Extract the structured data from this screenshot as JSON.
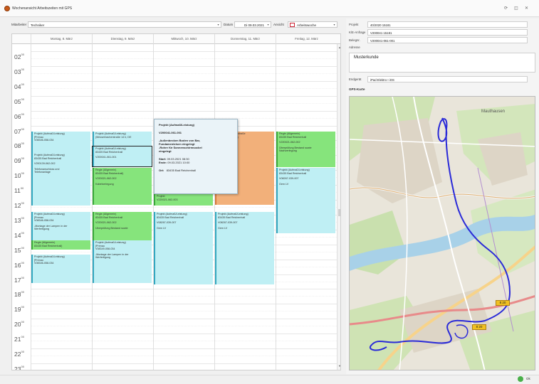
{
  "window": {
    "title": "Wochenansicht Arbeitszeiten mit GPS",
    "controls": [
      "⟳",
      "◫",
      "✕"
    ]
  },
  "toolbar": {
    "mitarbeiter_label": "Mitarbeiter",
    "mitarbeiter_value": "Techniker",
    "datum_label": "Datum",
    "datum_value": "Di 09.03.2021",
    "ansicht_label": "Ansicht",
    "ansicht_value": "Arbeitswoche"
  },
  "calendar": {
    "days": [
      "Montag, 8. März",
      "Dienstag, 9. März",
      "Mittwoch, 10. März",
      "Donnerstag, 11. März",
      "Freitag, 12. März"
    ],
    "hours": [
      "02",
      "03",
      "04",
      "05",
      "06",
      "07",
      "08",
      "09",
      "10",
      "11",
      "12",
      "13",
      "14",
      "15",
      "16",
      "17",
      "18",
      "19",
      "20",
      "21",
      "22",
      "23"
    ],
    "hour_suffix": "00",
    "events": [
      {
        "id": "mo1",
        "lines": [
          "Projekt (Aufmaß/Leistung)",
          "[Prenau",
          "V08346-058-034"
        ]
      },
      {
        "id": "mo2",
        "lines": [
          "Projekt (Aufmaß/Leistung)",
          "83435 Bad Reichenhall",
          "",
          "V200139-062-002",
          "",
          "Telefonanschluss und",
          "Telefonanlage"
        ]
      },
      {
        "id": "mo3",
        "lines": [
          "Projekt (Aufmaß/Leistung)",
          "[Prenau",
          "V08346-058-034",
          "",
          "-Montage der Lampen in der",
          "Werfertigung"
        ]
      },
      {
        "id": "mo4",
        "lines": [
          "Regie (Allgemein)",
          "83435 Bad Reichenhall)"
        ]
      },
      {
        "id": "mo5",
        "lines": [
          "Projekt (Aufmaß/Leistung)",
          "[Prenau",
          "V08346-058-034"
        ]
      },
      {
        "id": "di1",
        "lines": [
          "Projekt (Aufmaß/Leistung)",
          "(Messerbacherstraße 14 b, DE"
        ]
      },
      {
        "id": "di2",
        "lines": [
          "Projekt (Aufmaß/Leistung)",
          "83435 Bad Reichenhall",
          "",
          "V200041-061-001"
        ]
      },
      {
        "id": "di3",
        "lines": [
          "Regie (Allgemein)",
          "83435 Bad Reichenhall)",
          "",
          "V220021-062-002",
          "",
          "Kabelverlegung"
        ]
      },
      {
        "id": "di4",
        "lines": [
          "Regie (Allgemein)",
          "83435 Bad Reichenhall",
          "",
          "V220021-062-002",
          "",
          "Überprüfung Bestand sowie"
        ]
      },
      {
        "id": "di5",
        "lines": [
          "Projekt (Aufmaß/Leistung)",
          "[Prenau",
          "V08349-058-034",
          "",
          "-Montage der Lampen in der",
          "Werfertigung"
        ]
      },
      {
        "id": "mi1",
        "lines": [
          "Projekt",
          "V220021-062-003"
        ]
      },
      {
        "id": "mi2",
        "lines": [
          "Projekt (Aufmaß/Leistung)",
          "83435 Bad Reichenhall",
          "",
          "V08267-039-007",
          "",
          "Gem LV"
        ]
      },
      {
        "id": "do1",
        "lines": [
          "...ichshalle/Hügelstraße",
          "...ad Reichenhall)",
          "...002",
          "",
          "...llung"
        ]
      },
      {
        "id": "do2",
        "lines": [
          "Projekt (Aufmaß/Leistung)",
          "83435 Bad Reichenhall",
          "",
          "V08267-039-007",
          "",
          "Gem LV"
        ]
      },
      {
        "id": "fr1",
        "lines": [
          "Regie (Allgemein)",
          "83435 Bad Reichenhall",
          "",
          "V220021-062-002",
          "",
          "Überprüfung Bestand sowie",
          "Nachverlegung"
        ]
      },
      {
        "id": "fr2",
        "lines": [
          "Projekt (Aufmaß/Leistung)",
          "83435 Bad Reichenhall",
          "",
          "V08267-039-007",
          "",
          "Gem LV"
        ]
      }
    ],
    "colors": {
      "project": "#bfeff4",
      "regie": "#86e47c",
      "orange": "#f2b07a"
    }
  },
  "tooltip": {
    "title": "Projekt (Aufmaß/Leistung)",
    "number": "V200041-061-001",
    "desc1": "-Außenbecken Boden von Bar,",
    "desc2": "Fundamenteisen eingelegt",
    "desc3": "-Rohre für Sonnenschirmsockel",
    "desc4": "eingelegt",
    "start_label": "Start:",
    "start_value": "09.03.2021   08:30",
    "ende_label": "Ende:",
    "ende_value": "09.03.2021   10:00",
    "ort_label": "Ort:",
    "ort_value": "83435 Bad Reichenhall"
  },
  "details": {
    "projekt_label": "Projekt",
    "projekt_value": "40/2020 15181",
    "anfrage_label": "K/E-Anfrage",
    "anfrage_value": "V200041 15181",
    "beleg_label": "Belegnr.",
    "beleg_value": "V200041-061-001",
    "adresse_label": "Adresse",
    "adresse_value": "Musterkunde",
    "endgeraet_label": "Endgerät",
    "endgeraet_value": "iPad Elektro I iOS",
    "gps_label": "GPS-Karte"
  },
  "map": {
    "town_label": "Mauthausen",
    "tag1": "8 20",
    "tag2": "8 20",
    "route_color": "#2a2ad8",
    "marker_color": "#f0c020"
  },
  "statusbar": {
    "ok_label": "Ok"
  }
}
